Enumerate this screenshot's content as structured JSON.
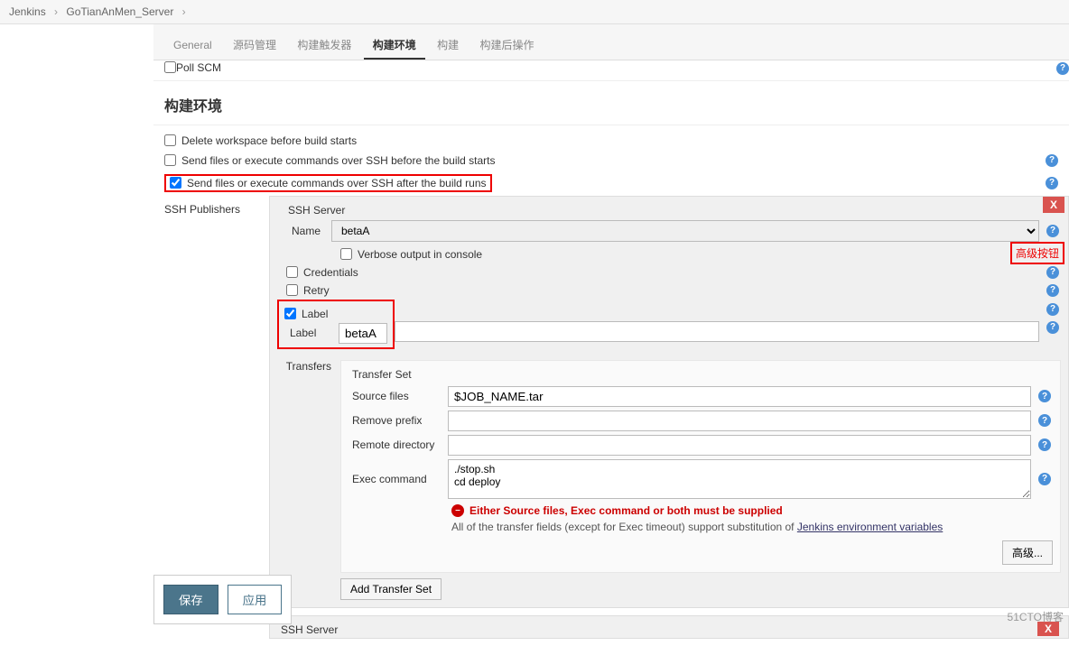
{
  "breadcrumb": {
    "root": "Jenkins",
    "project": "GoTianAnMen_Server"
  },
  "tabs": [
    "General",
    "源码管理",
    "构建触发器",
    "构建环境",
    "构建",
    "构建后操作"
  ],
  "activeTab": "构建环境",
  "poll": {
    "label": "Poll SCM"
  },
  "heading": "构建环境",
  "checks": {
    "delWs": "Delete workspace before build starts",
    "sshBefore": "Send files or execute commands over SSH before the build starts",
    "sshAfter": "Send files or execute commands over SSH after the build runs"
  },
  "ssh": {
    "publishersLabel": "SSH Publishers",
    "serverLabel": "SSH Server",
    "nameLabel": "Name",
    "nameValue": "betaA",
    "verbose": "Verbose output in console",
    "credentials": "Credentials",
    "retry": "Retry",
    "labelChk": "Label",
    "labelField": "Label",
    "labelValue": "betaA",
    "transfersLabel": "Transfers",
    "transferSet": "Transfer Set",
    "sourceFiles": "Source files",
    "sourceVal": "$JOB_NAME.tar",
    "removePrefix": "Remove prefix",
    "removeVal": "",
    "remoteDir": "Remote directory",
    "remoteVal": "",
    "execCmd": "Exec command",
    "execVal": "./stop.sh\ncd deploy",
    "error": "Either Source files, Exec command or both must be supplied",
    "info1": "All of the transfer fields (except for Exec timeout) support substitution of ",
    "infoLink": "Jenkins environment variables",
    "advanced": "高级...",
    "addTransfer": "Add Transfer Set",
    "annotation": "高级按钮",
    "server2": "SSH Server"
  },
  "buttons": {
    "save": "保存",
    "apply": "应用"
  },
  "watermark": "51CTO博客",
  "helpGlyph": "?"
}
